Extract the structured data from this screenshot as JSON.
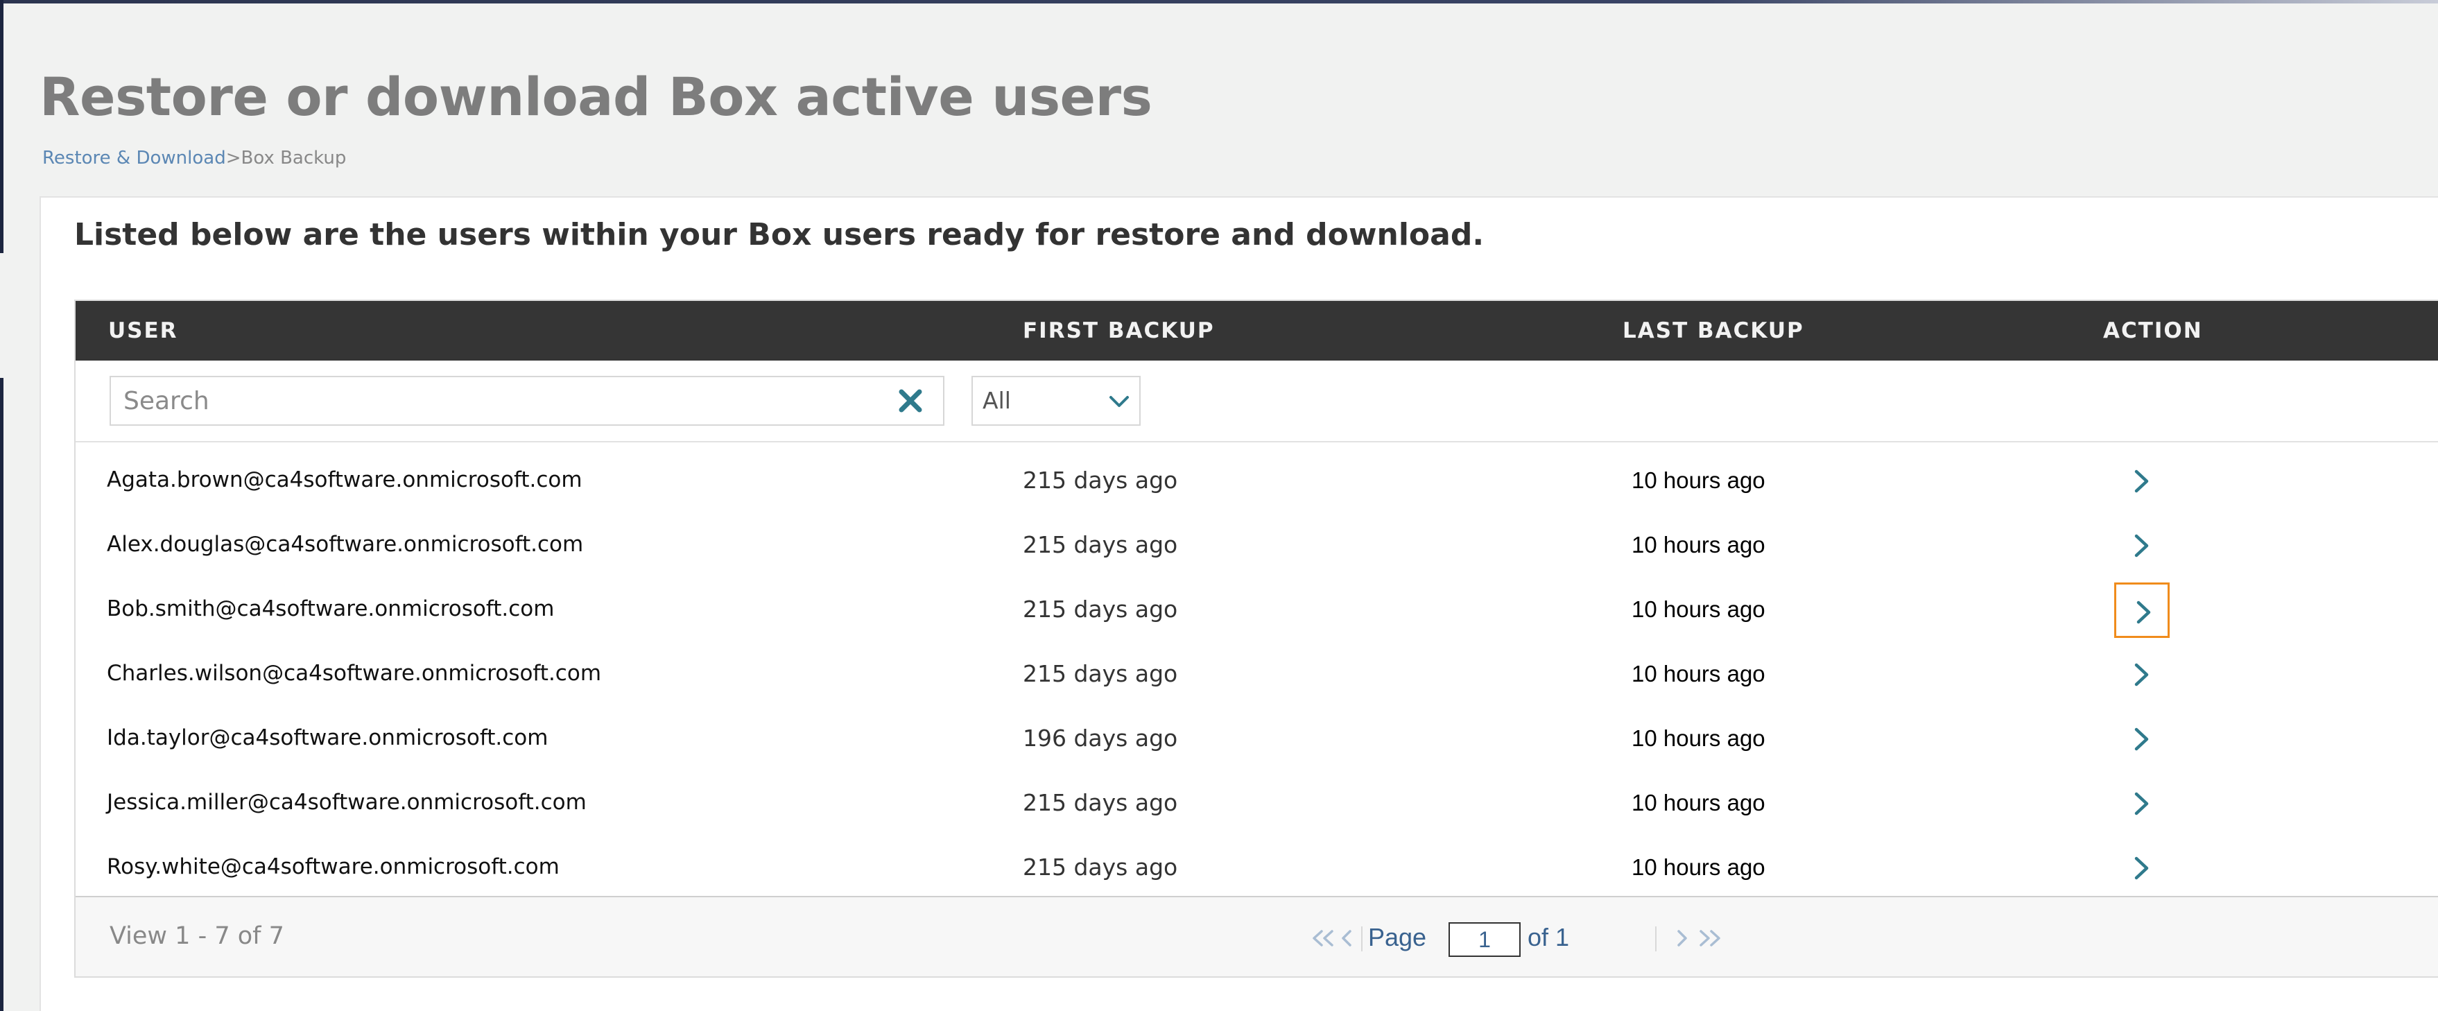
{
  "page": {
    "title": "Restore or download Box active users",
    "breadcrumb": {
      "link": "Restore & Download",
      "current": ">Box Backup"
    },
    "intro": "Listed below are the users within your Box users ready for restore and download."
  },
  "table": {
    "headers": {
      "user": "USER",
      "first_backup": "FIRST BACKUP",
      "last_backup": "LAST BACKUP",
      "action": "ACTION"
    },
    "search": {
      "placeholder": "Search",
      "value": ""
    },
    "filter": {
      "selected": "All"
    },
    "rows": [
      {
        "user": "Agata.brown@ca4software.onmicrosoft.com",
        "first_backup": "215 days ago",
        "last_backup": "10 hours ago"
      },
      {
        "user": "Alex.douglas@ca4software.onmicrosoft.com",
        "first_backup": "215 days ago",
        "last_backup": "10 hours ago"
      },
      {
        "user": "Bob.smith@ca4software.onmicrosoft.com",
        "first_backup": "215 days ago",
        "last_backup": "10 hours ago"
      },
      {
        "user": "Charles.wilson@ca4software.onmicrosoft.com",
        "first_backup": "215 days ago",
        "last_backup": "10 hours ago"
      },
      {
        "user": "Ida.taylor@ca4software.onmicrosoft.com",
        "first_backup": "196 days ago",
        "last_backup": "10 hours ago"
      },
      {
        "user": "Jessica.miller@ca4software.onmicrosoft.com",
        "first_backup": "215 days ago",
        "last_backup": "10 hours ago"
      },
      {
        "user": "Rosy.white@ca4software.onmicrosoft.com",
        "first_backup": "215 days ago",
        "last_backup": "10 hours ago"
      }
    ]
  },
  "pager": {
    "view_info": "View 1 - 7 of 7",
    "page_label": "Page",
    "page_value": "1",
    "of_label": "of 1"
  },
  "icons": {
    "clear": "close-x-icon",
    "select": "chevron-down-icon",
    "row_action": "chevron-right-icon",
    "pager_first": "double-chevron-left-icon",
    "pager_prev": "chevron-left-icon",
    "pager_next": "chevron-right-icon",
    "pager_last": "double-chevron-right-icon"
  },
  "colors": {
    "header_bg": "#353535",
    "accent": "#2f7a8c",
    "focus": "#f08c1c",
    "link": "#5b87b4"
  }
}
